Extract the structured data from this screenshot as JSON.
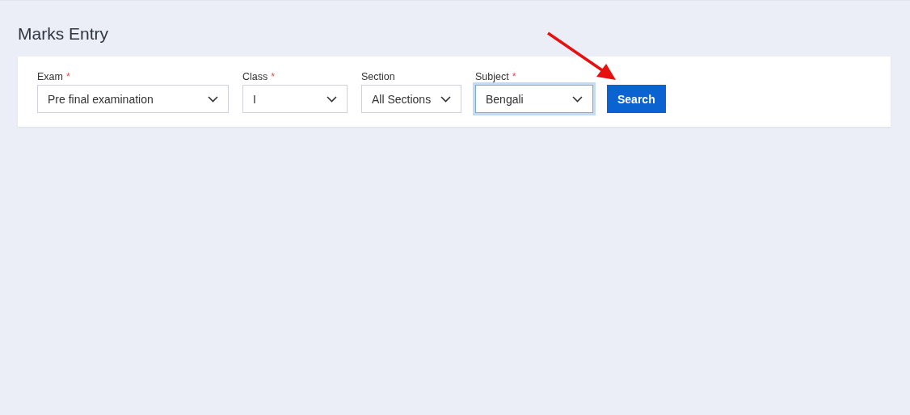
{
  "page": {
    "title": "Marks Entry"
  },
  "filters": [
    {
      "label": "Exam",
      "required_mark": "*",
      "value": "Pre final examination",
      "focused": false
    },
    {
      "label": "Class",
      "required_mark": "*",
      "value": "I",
      "focused": false
    },
    {
      "label": "Section",
      "value": "All Sections",
      "focused": false
    },
    {
      "label": "Subject",
      "required_mark": "*",
      "value": "Bengali",
      "focused": true
    }
  ],
  "search_button": {
    "label": "Search"
  }
}
